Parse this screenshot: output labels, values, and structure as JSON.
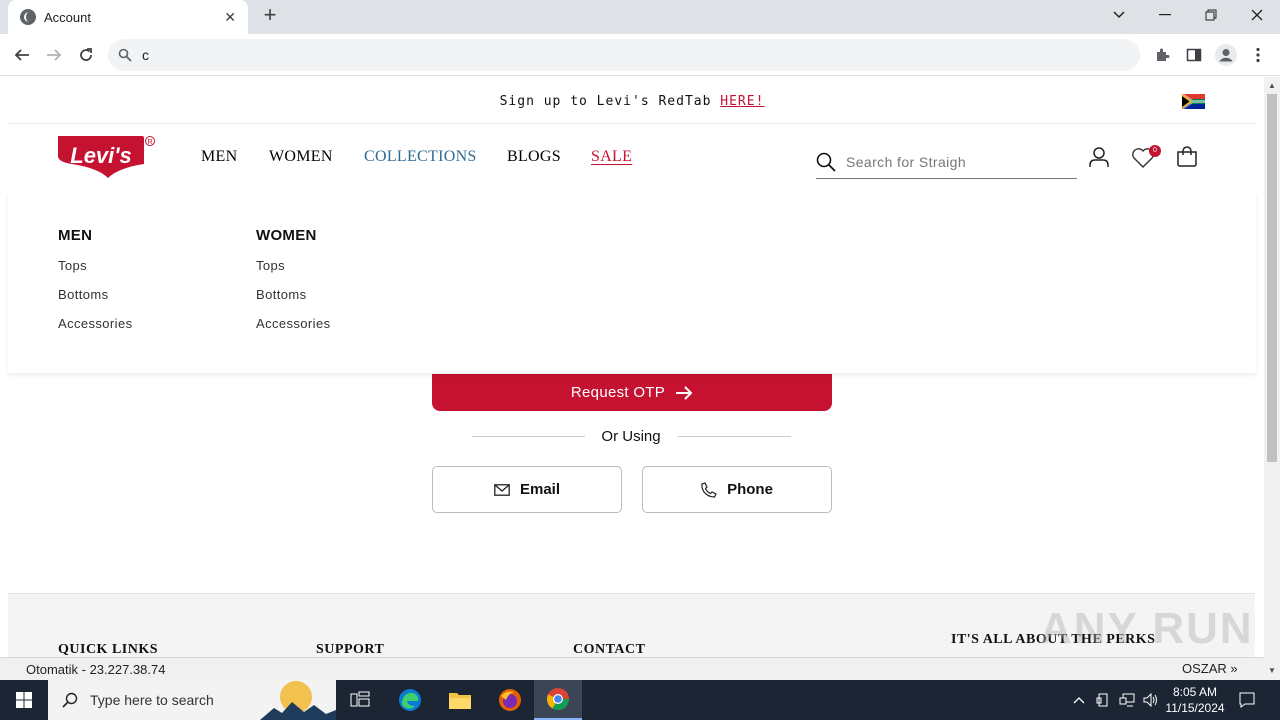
{
  "browser": {
    "tab_title": "Account",
    "tab_close": "✕",
    "new_tab": "+",
    "url": "c"
  },
  "promo": {
    "text": "Sign up to Levi's RedTab ",
    "link": "HERE!"
  },
  "logo_text": "Levi's",
  "nav": {
    "items": [
      {
        "label": "MEN",
        "color": "#111111"
      },
      {
        "label": "WOMEN",
        "color": "#111111"
      },
      {
        "label": "COLLECTIONS",
        "color": "#2c6b92"
      },
      {
        "label": "BLOGS",
        "color": "#111111"
      },
      {
        "label": "SALE",
        "color": "#c41230"
      }
    ]
  },
  "search": {
    "placeholder": "Search for Straigh"
  },
  "wishlist_count": "0",
  "mega_menu": {
    "columns": [
      {
        "heading": "MEN",
        "items": [
          "Tops",
          "Bottoms",
          "Accessories"
        ]
      },
      {
        "heading": "WOMEN",
        "items": [
          "Tops",
          "Bottoms",
          "Accessories"
        ]
      }
    ]
  },
  "login": {
    "otp_label": "Request OTP",
    "or_using": "Or Using",
    "email_label": "Email",
    "phone_label": "Phone"
  },
  "footer": {
    "quick_links": "QUICK LINKS",
    "support": "SUPPORT",
    "contact": "CONTACT",
    "perks": "IT'S ALL ABOUT THE PERKS"
  },
  "status": {
    "left": "Otomatik - 23.227.38.74",
    "right": "OSZAR »"
  },
  "watermark": "ANY RUN",
  "taskbar": {
    "search_placeholder": "Type here to search",
    "time": "8:05 AM",
    "date": "11/15/2024"
  },
  "colors": {
    "brand_red": "#c41230",
    "collections_blue": "#2c6b92"
  }
}
